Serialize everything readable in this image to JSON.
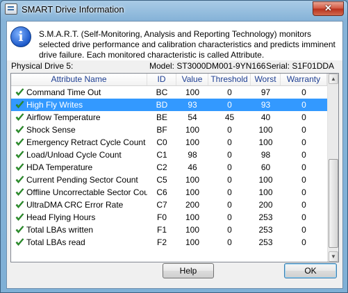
{
  "window": {
    "title": "SMART Drive Information",
    "close_label": "✕"
  },
  "info": {
    "icon": "info-icon",
    "icon_glyph": "i",
    "text": "S.M.A.R.T. (Self-Monitoring, Analysis and Reporting Technology) monitors selected drive performance and calibration characteristics and predicts imminent drive failure. Each monitored characteristic is called Attribute."
  },
  "drive": {
    "physical": "Physical Drive 5:",
    "model": "Model: ST3000DM001-9YN166",
    "serial": "Serial: S1F01DDA"
  },
  "table": {
    "headers": [
      "Attribute Name",
      "ID",
      "Value",
      "Threshold",
      "Worst",
      "Warranty"
    ],
    "selected_index": 1,
    "rows": [
      {
        "name": "Command Time Out",
        "id": "BC",
        "value": "100",
        "threshold": "0",
        "worst": "97",
        "warranty": "0"
      },
      {
        "name": "High Fly Writes",
        "id": "BD",
        "value": "93",
        "threshold": "0",
        "worst": "93",
        "warranty": "0"
      },
      {
        "name": "Airflow Temperature",
        "id": "BE",
        "value": "54",
        "threshold": "45",
        "worst": "40",
        "warranty": "0"
      },
      {
        "name": "Shock Sense",
        "id": "BF",
        "value": "100",
        "threshold": "0",
        "worst": "100",
        "warranty": "0"
      },
      {
        "name": "Emergency Retract Cycle Count",
        "id": "C0",
        "value": "100",
        "threshold": "0",
        "worst": "100",
        "warranty": "0"
      },
      {
        "name": "Load/Unload Cycle Count",
        "id": "C1",
        "value": "98",
        "threshold": "0",
        "worst": "98",
        "warranty": "0"
      },
      {
        "name": "HDA Temperature",
        "id": "C2",
        "value": "46",
        "threshold": "0",
        "worst": "60",
        "warranty": "0"
      },
      {
        "name": "Current Pending Sector Count",
        "id": "C5",
        "value": "100",
        "threshold": "0",
        "worst": "100",
        "warranty": "0"
      },
      {
        "name": "Offline Uncorrectable Sector Cour",
        "id": "C6",
        "value": "100",
        "threshold": "0",
        "worst": "100",
        "warranty": "0"
      },
      {
        "name": "UltraDMA CRC Error Rate",
        "id": "C7",
        "value": "200",
        "threshold": "0",
        "worst": "200",
        "warranty": "0"
      },
      {
        "name": "Head Flying Hours",
        "id": "F0",
        "value": "100",
        "threshold": "0",
        "worst": "253",
        "warranty": "0"
      },
      {
        "name": "Total LBAs written",
        "id": "F1",
        "value": "100",
        "threshold": "0",
        "worst": "253",
        "warranty": "0"
      },
      {
        "name": "Total LBAs read",
        "id": "F2",
        "value": "100",
        "threshold": "0",
        "worst": "253",
        "warranty": "0"
      }
    ],
    "status_icon": "green-check-icon"
  },
  "buttons": {
    "help": "Help",
    "ok": "OK"
  },
  "colors": {
    "selection": "#3399ff",
    "header_text": "#1d3e92",
    "check": "#2f9e2f"
  }
}
